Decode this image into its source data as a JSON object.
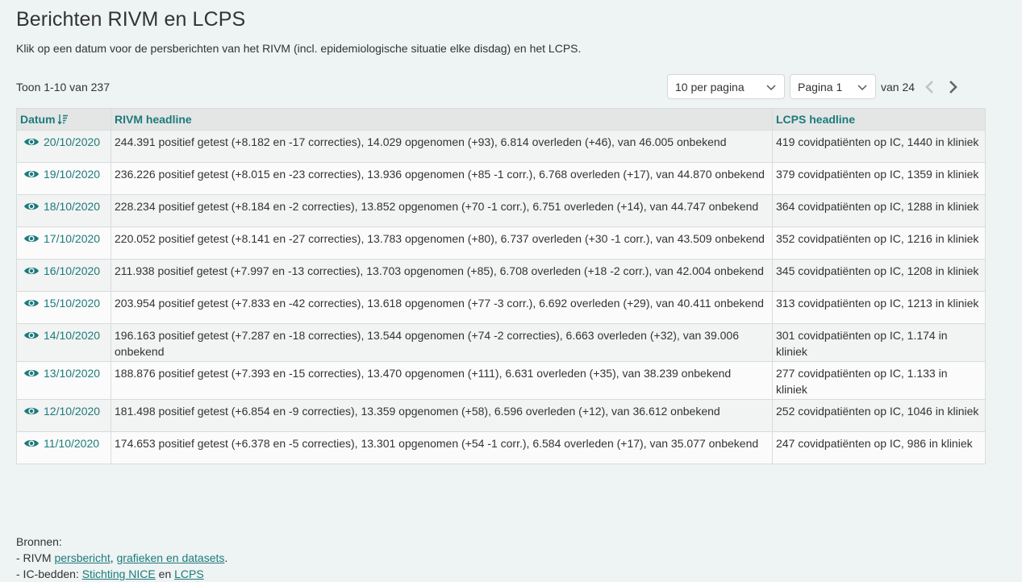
{
  "title": "Berichten RIVM en LCPS",
  "subtitle": "Klik op een datum voor de persberichten van het RIVM (incl. epidemiologische situatie elke disdag) en het LCPS.",
  "count_text": "Toon 1-10 van 237",
  "per_page_label": "10 per pagina",
  "page_label": "Pagina 1",
  "of_text": "van 24",
  "columns": {
    "date": "Datum",
    "rivm": "RIVM headline",
    "lcps": "LCPS headline"
  },
  "accent_color": "#1d7a7a",
  "rows": [
    {
      "date": "20/10/2020",
      "rivm": "244.391 positief getest (+8.182 en -17 correcties), 14.029 opgenomen (+93), 6.814 overleden (+46), van 46.005 onbekend",
      "lcps": "419 covidpatiënten op IC, 1440 in kliniek"
    },
    {
      "date": "19/10/2020",
      "rivm": "236.226 positief getest (+8.015 en -23 correcties), 13.936 opgenomen (+85 -1 corr.), 6.768 overleden (+17), van 44.870 onbekend",
      "lcps": "379 covidpatiënten op IC, 1359 in kliniek"
    },
    {
      "date": "18/10/2020",
      "rivm": "228.234 positief getest (+8.184 en -2 correcties), 13.852 opgenomen (+70 -1 corr.), 6.751 overleden (+14), van 44.747 onbekend",
      "lcps": "364 covidpatiënten op IC, 1288 in kliniek"
    },
    {
      "date": "17/10/2020",
      "rivm": "220.052 positief getest (+8.141 en -27 correcties), 13.783 opgenomen (+80), 6.737 overleden (+30 -1 corr.), van 43.509 onbekend",
      "lcps": "352 covidpatiënten op IC, 1216 in kliniek"
    },
    {
      "date": "16/10/2020",
      "rivm": "211.938 positief getest (+7.997 en -13 correcties), 13.703 opgenomen (+85), 6.708 overleden (+18 -2 corr.), van 42.004 onbekend",
      "lcps": "345 covidpatiënten op IC, 1208 in kliniek"
    },
    {
      "date": "15/10/2020",
      "rivm": "203.954 positief getest (+7.833 en -42 correcties), 13.618 opgenomen (+77 -3 corr.), 6.692 overleden (+29), van 40.411 onbekend",
      "lcps": "313 covidpatiënten op IC, 1213 in kliniek"
    },
    {
      "date": "14/10/2020",
      "rivm": "196.163 positief getest (+7.287 en -18 correcties), 13.544 opgenomen (+74 -2 correcties), 6.663 overleden (+32), van 39.006 onbekend",
      "lcps": "301 covidpatiënten op IC, 1.174 in kliniek"
    },
    {
      "date": "13/10/2020",
      "rivm": "188.876 positief getest (+7.393 en -15 correcties), 13.470 opgenomen (+111), 6.631 overleden (+35), van 38.239 onbekend",
      "lcps": "277 covidpatiënten op IC, 1.133 in kliniek"
    },
    {
      "date": "12/10/2020",
      "rivm": "181.498 positief getest (+6.854 en -9 correcties), 13.359 opgenomen (+58), 6.596 overleden (+12), van 36.612 onbekend",
      "lcps": "252 covidpatiënten op IC, 1046 in kliniek"
    },
    {
      "date": "11/10/2020",
      "rivm": "174.653 positief getest (+6.378 en -5 correcties), 13.301 opgenomen (+54 -1 corr.), 6.584 overleden (+17), van 35.077 onbekend",
      "lcps": "247 covidpatiënten op IC, 986 in kliniek"
    }
  ],
  "sources": {
    "heading": "Bronnen:",
    "line1_prefix": "- RIVM ",
    "line1_link1": "persbericht",
    "line1_sep": ", ",
    "line1_link2": "grafieken en datasets",
    "line1_suffix": ".",
    "line2_prefix": "- IC-bedden: ",
    "line2_link1": "Stichting NICE",
    "line2_sep": " en ",
    "line2_link2": "LCPS"
  }
}
